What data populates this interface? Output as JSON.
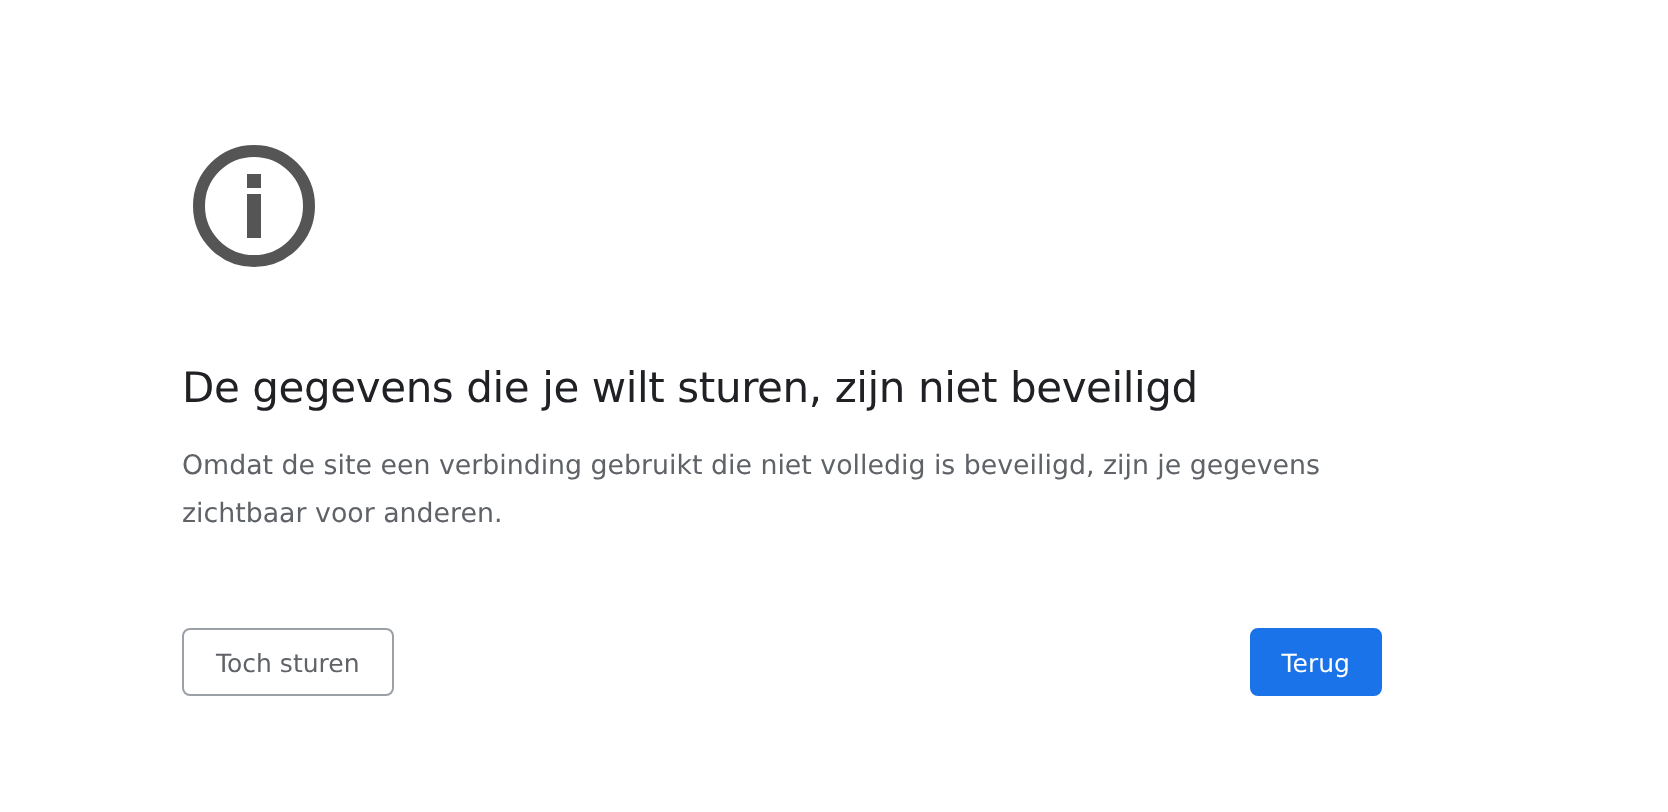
{
  "heading": "De gegevens die je wilt sturen, zijn niet beveiligd",
  "message": "Omdat de site een verbinding gebruikt die niet volledig is beveiligd, zijn je gegevens zichtbaar voor anderen.",
  "buttons": [
    {
      "label": "Toch sturen",
      "kind": "secondary"
    },
    {
      "label": "Terug",
      "kind": "primary"
    }
  ]
}
